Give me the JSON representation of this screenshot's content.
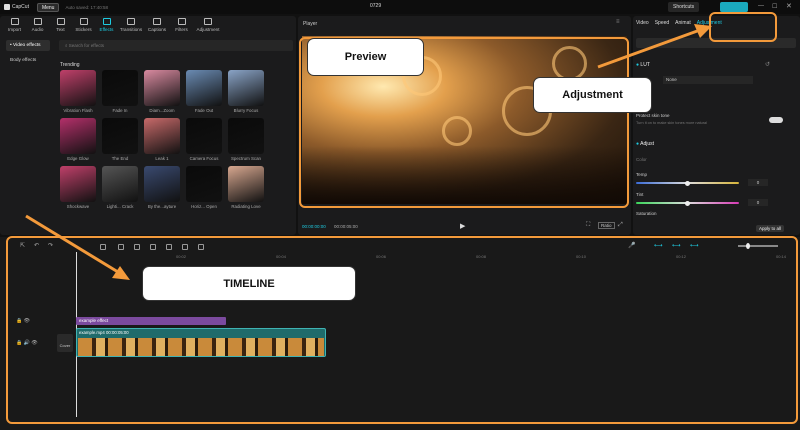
{
  "app": {
    "brand": "CapCut",
    "menu_label": "Menu",
    "autosave": "Auto saved: 17:40:58",
    "project_title": "0729",
    "shortcuts_label": "Shortcuts"
  },
  "toolbar": {
    "items": [
      {
        "label": "Import",
        "icon": "import-icon"
      },
      {
        "label": "Audio",
        "icon": "audio-icon"
      },
      {
        "label": "Text",
        "icon": "text-icon"
      },
      {
        "label": "Stickers",
        "icon": "sticker-icon"
      },
      {
        "label": "Effects",
        "icon": "effects-icon",
        "active": true
      },
      {
        "label": "Transitions",
        "icon": "transition-icon"
      },
      {
        "label": "Captions",
        "icon": "captions-icon"
      },
      {
        "label": "Filters",
        "icon": "filters-icon"
      },
      {
        "label": "Adjustment",
        "icon": "adjustment-icon"
      }
    ]
  },
  "left_nav": {
    "items": [
      {
        "label": "• Video effects",
        "active": true
      },
      {
        "label": "Body effects",
        "active": false
      }
    ]
  },
  "search": {
    "placeholder": "Search for effects"
  },
  "effects": {
    "section": "Trending",
    "items": [
      {
        "label": "Vibration Flash",
        "color": "#c0406a"
      },
      {
        "label": "Fade In",
        "color": "#0a0a0a"
      },
      {
        "label": "Diam...Zoom",
        "color": "#d98aa0"
      },
      {
        "label": "Fade Out",
        "color": "#6a8bb3"
      },
      {
        "label": "Blurry Focus",
        "color": "#8aa4c7"
      },
      {
        "label": "Edge Glow",
        "color": "#b4306a"
      },
      {
        "label": "The End",
        "color": "#0a0a0a"
      },
      {
        "label": "Leak 1",
        "color": "#c86a6a"
      },
      {
        "label": "Camera Focus",
        "color": "#0a0a0a"
      },
      {
        "label": "Spectrum Scan",
        "color": "#0a0a0a"
      },
      {
        "label": "Shockwave",
        "color": "#c0406a"
      },
      {
        "label": "Lighti... Crack",
        "color": "#555"
      },
      {
        "label": "By the...ayture",
        "color": "#3a4a70"
      },
      {
        "label": "Horiz... Open",
        "color": "#0a0a0a"
      },
      {
        "label": "Radiating Love",
        "color": "#d8a890"
      }
    ]
  },
  "player": {
    "title": "Player",
    "time_current": "00:00:00:00",
    "time_total": "00:00:05:00",
    "ratio_label": "Ratio"
  },
  "right_panel": {
    "tabs": [
      "Video",
      "Speed",
      "Animat",
      "Adjustment"
    ],
    "lut_label": "LUT",
    "lut_value": "None",
    "protect_label": "Protect skin tone",
    "protect_desc": "Turn it on to make skin tones more natural",
    "adjust_label": "Adjust",
    "color_label": "Color",
    "temp_label": "Temp",
    "temp_value": "0",
    "tint_label": "Tint",
    "tint_value": "0",
    "saturation_label": "Saturation",
    "saturation_value": "0",
    "apply_all": "Apply to all"
  },
  "timeline": {
    "ruler": [
      "00:02",
      "00:04",
      "00:06",
      "00:08",
      "00:10",
      "00:12",
      "00:14"
    ],
    "effect_label": "example effect",
    "clip_label": "example.mp4",
    "clip_duration": "00:00:05:00",
    "cover_label": "Cover"
  },
  "annotations": {
    "preview": "Preview",
    "adjustment": "Adjustment",
    "timeline": "TIMELINE"
  },
  "colors": {
    "accent": "#1ecbe1",
    "callout_orange": "#f39a3b",
    "effect_track": "#7b4a9e",
    "clip_track": "#1f6b6b"
  }
}
